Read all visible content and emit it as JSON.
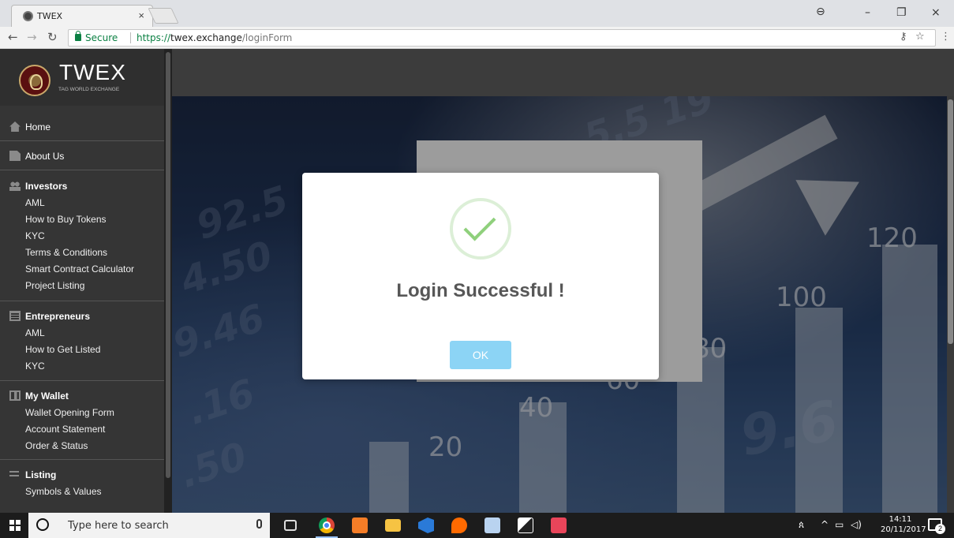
{
  "browser": {
    "tab_title": "TWEX",
    "tab_close": "×",
    "address": {
      "secure_label": "Secure",
      "scheme": "https://",
      "host": "twex.exchange",
      "path": "/loginForm"
    },
    "window_controls": [
      "–",
      "❐",
      "×"
    ]
  },
  "sidebar": {
    "brand_name": "TWEX",
    "brand_tagline": "TAG WORLD EXCHANGE",
    "home": "Home",
    "about": "About Us",
    "investors": {
      "title": "Investors",
      "items": [
        "AML",
        "How to Buy Tokens",
        "KYC",
        "Terms & Conditions",
        "Smart Contract Calculator",
        "Project Listing"
      ]
    },
    "entrepreneurs": {
      "title": "Entrepreneurs",
      "items": [
        "AML",
        "How to Get Listed",
        "KYC"
      ]
    },
    "wallet": {
      "title": "My Wallet",
      "items": [
        "Wallet Opening Form",
        "Account Statement",
        "Order & Status"
      ]
    },
    "listing": {
      "title": "Listing",
      "items": [
        "Symbols & Values"
      ]
    }
  },
  "hero": {
    "numbers": [
      "120",
      "100",
      "80",
      "60",
      "40",
      "20"
    ]
  },
  "modal": {
    "title": "Login Successful !",
    "ok_label": "OK"
  },
  "taskbar": {
    "search_placeholder": "Type here to search",
    "time": "14:11",
    "date": "20/11/2017",
    "notification_count": "2"
  }
}
